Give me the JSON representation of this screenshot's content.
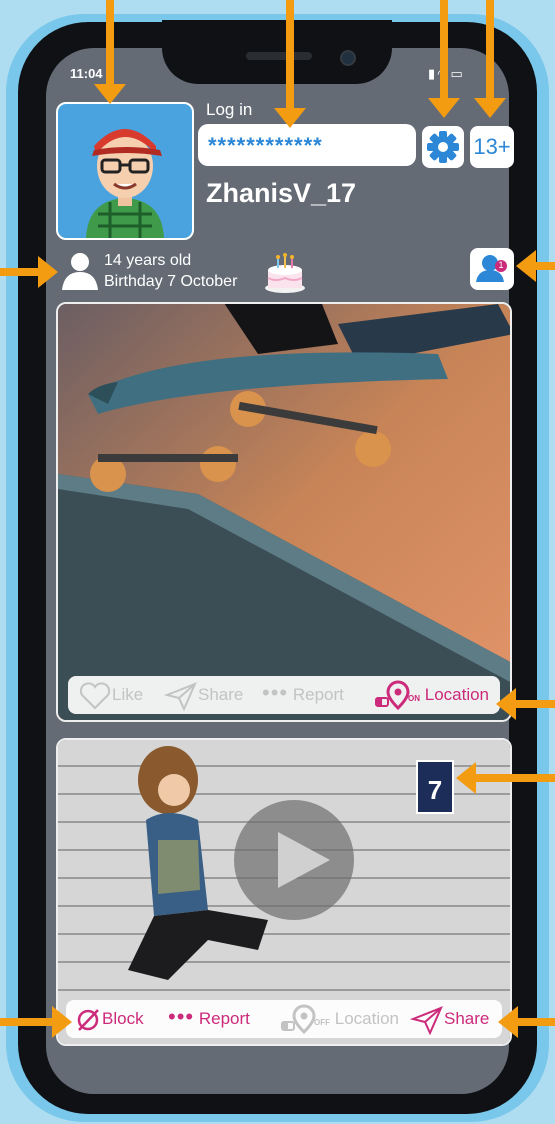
{
  "status_bar": {
    "time": "11:04"
  },
  "profile": {
    "login_label": "Log in",
    "password_value": "************",
    "age_badge": "13+",
    "username": "ZhanisV_17",
    "age_text": "14 years old",
    "birthday_text": "Birthday 7 October",
    "friend_request_count": "1"
  },
  "post1": {
    "actions": {
      "like": "Like",
      "share": "Share",
      "report": "Report",
      "location": "Location",
      "location_state": "ON"
    }
  },
  "post2": {
    "badge_text": "7",
    "actions": {
      "block": "Block",
      "report": "Report",
      "location": "Location",
      "location_state": "OFF",
      "share": "Share"
    }
  },
  "colors": {
    "accent": "#cc2a7a",
    "annotation": "#f39c12",
    "blue": "#2c87d7"
  }
}
